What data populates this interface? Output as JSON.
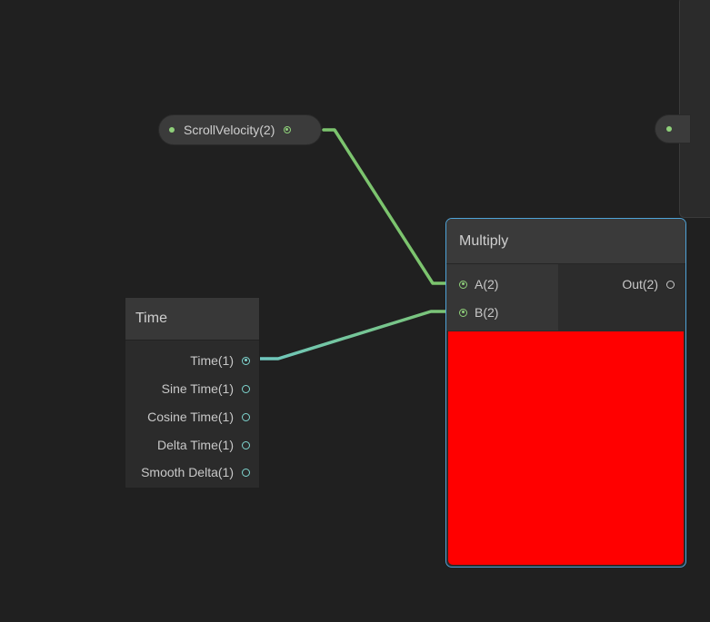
{
  "graph": {
    "property_node": {
      "label": "ScrollVelocity(2)"
    },
    "time_node": {
      "title": "Time",
      "outputs": [
        "Time(1)",
        "Sine Time(1)",
        "Cosine Time(1)",
        "Delta Time(1)",
        "Smooth Delta(1)"
      ]
    },
    "multiply_node": {
      "title": "Multiply",
      "inputs": [
        "A(2)",
        "B(2)"
      ],
      "output": "Out(2)",
      "preview_color": "#ff0000"
    }
  },
  "colors": {
    "background": "#202020",
    "vector2_wire": "#7cc46e",
    "float_wire": "#6fc7c0",
    "selection": "#4fa3d8"
  }
}
